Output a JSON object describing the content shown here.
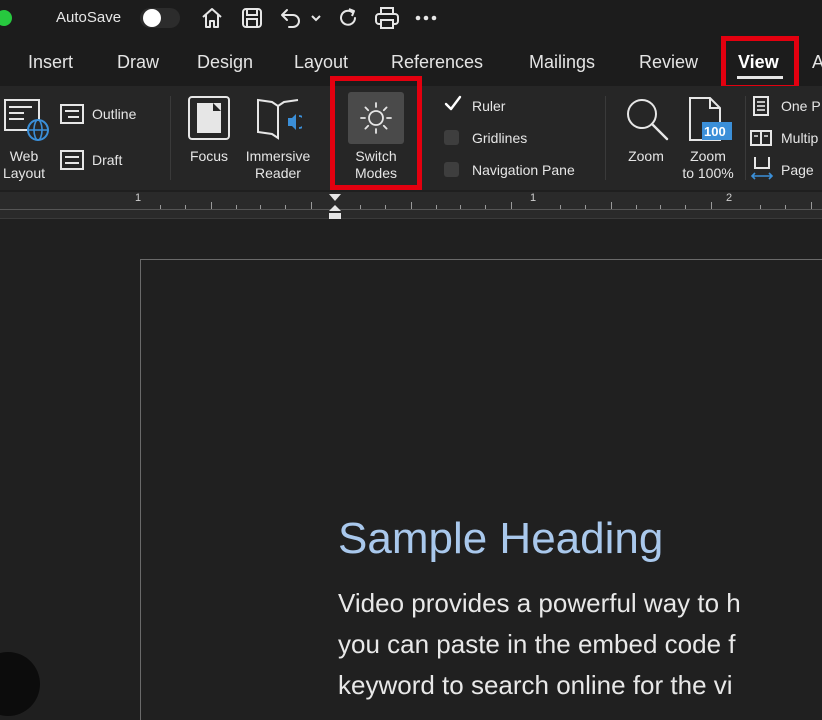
{
  "titlebar": {
    "autosave_label": "AutoSave",
    "quick_access": [
      "home-icon",
      "save-icon",
      "undo-icon",
      "chevron-down-icon",
      "redo-icon",
      "print-icon",
      "more-icon"
    ]
  },
  "tabs": [
    {
      "label": "Insert"
    },
    {
      "label": "Draw"
    },
    {
      "label": "Design"
    },
    {
      "label": "Layout"
    },
    {
      "label": "References"
    },
    {
      "label": "Mailings"
    },
    {
      "label": "Review"
    },
    {
      "label": "View",
      "active": true
    },
    {
      "label": "A"
    }
  ],
  "ribbon": {
    "web_layout": [
      "Web",
      "Layout"
    ],
    "outline": "Outline",
    "draft": "Draft",
    "focus": "Focus",
    "immersive_reader": [
      "Immersive",
      "Reader"
    ],
    "switch_modes": [
      "Switch",
      "Modes"
    ],
    "ruler": {
      "label": "Ruler",
      "checked": true
    },
    "gridlines": {
      "label": "Gridlines",
      "checked": false
    },
    "navigation_pane": {
      "label": "Navigation Pane",
      "checked": false
    },
    "zoom": "Zoom",
    "zoom_100": [
      "Zoom",
      "to 100%"
    ],
    "zoom_100_badge": "100",
    "one_page": "One P",
    "multiple_pages": "Multip",
    "page_width": "Page"
  },
  "ruler": {
    "numbers": [
      "1",
      "1",
      "2"
    ]
  },
  "document": {
    "heading": "Sample Heading",
    "body_lines": [
      "Video provides a powerful way to h",
      "you can paste in the embed code f",
      "keyword to search online for the vi"
    ]
  },
  "colors": {
    "highlight": "#e3000f",
    "heading": "#a9c8ec",
    "accent_blue": "#3b8fd8"
  }
}
